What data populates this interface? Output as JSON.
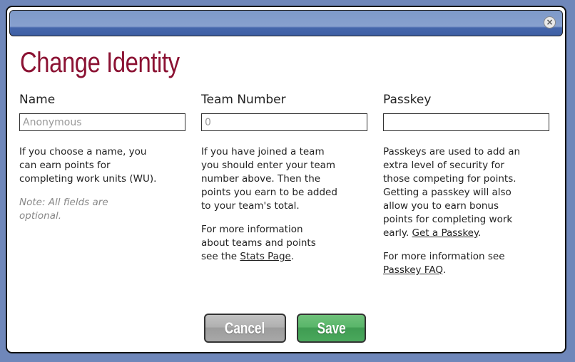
{
  "dialog": {
    "title": "Change Identity",
    "close_icon": "×"
  },
  "fields": {
    "name": {
      "label": "Name",
      "placeholder": "Anonymous",
      "value": "",
      "description": "If you choose a name, you can earn points for completing work units (WU).",
      "note": "Note: All fields are optional."
    },
    "team": {
      "label": "Team Number",
      "placeholder": "0",
      "value": "",
      "description": "If you have joined a team you should enter your team number above. Then the points you earn to be added to your team's total.",
      "more_prefix": "For more information about teams and points see the ",
      "more_link": "Stats Page",
      "more_suffix": "."
    },
    "passkey": {
      "label": "Passkey",
      "placeholder": "",
      "value": "",
      "description": "Passkeys are used to add an extra level of security for those competing for points. Getting a passkey will also allow you to earn bonus points for completing work early. ",
      "get_link": "Get a Passkey",
      "get_suffix": ".",
      "more_prefix": "For more information see ",
      "more_link": "Passkey FAQ",
      "more_suffix": "."
    }
  },
  "buttons": {
    "cancel": "Cancel",
    "save": "Save"
  }
}
